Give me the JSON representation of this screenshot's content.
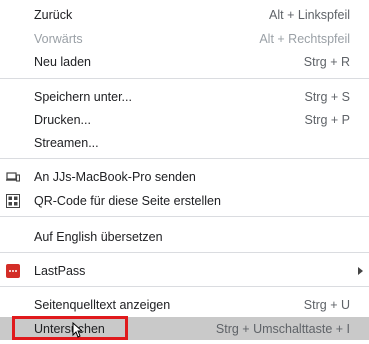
{
  "menu": {
    "items": [
      {
        "label": "Zurück",
        "shortcut": "Alt + Linkspfeil"
      },
      {
        "label": "Vorwärts",
        "shortcut": "Alt + Rechtspfeil"
      },
      {
        "label": "Neu laden",
        "shortcut": "Strg + R"
      },
      {
        "label": "Speichern unter...",
        "shortcut": "Strg + S"
      },
      {
        "label": "Drucken...",
        "shortcut": "Strg + P"
      },
      {
        "label": "Streamen...",
        "shortcut": ""
      },
      {
        "label": "An JJs-MacBook-Pro senden",
        "shortcut": "",
        "icon": "laptop-phone-icon"
      },
      {
        "label": "QR-Code für diese Seite erstellen",
        "shortcut": "",
        "icon": "qr-code-icon"
      },
      {
        "label": "Auf English übersetzen",
        "shortcut": ""
      },
      {
        "label": "LastPass",
        "shortcut": "",
        "icon": "lastpass-icon"
      },
      {
        "label": "Seitenquelltext anzeigen",
        "shortcut": "Strg + U"
      },
      {
        "label": "Untersuchen",
        "shortcut": "Strg + Umschalttaste + I"
      }
    ]
  },
  "colors": {
    "highlight": "#c9c9c9",
    "focus_box": "#e0191c",
    "lastpass": "#d32d27"
  }
}
